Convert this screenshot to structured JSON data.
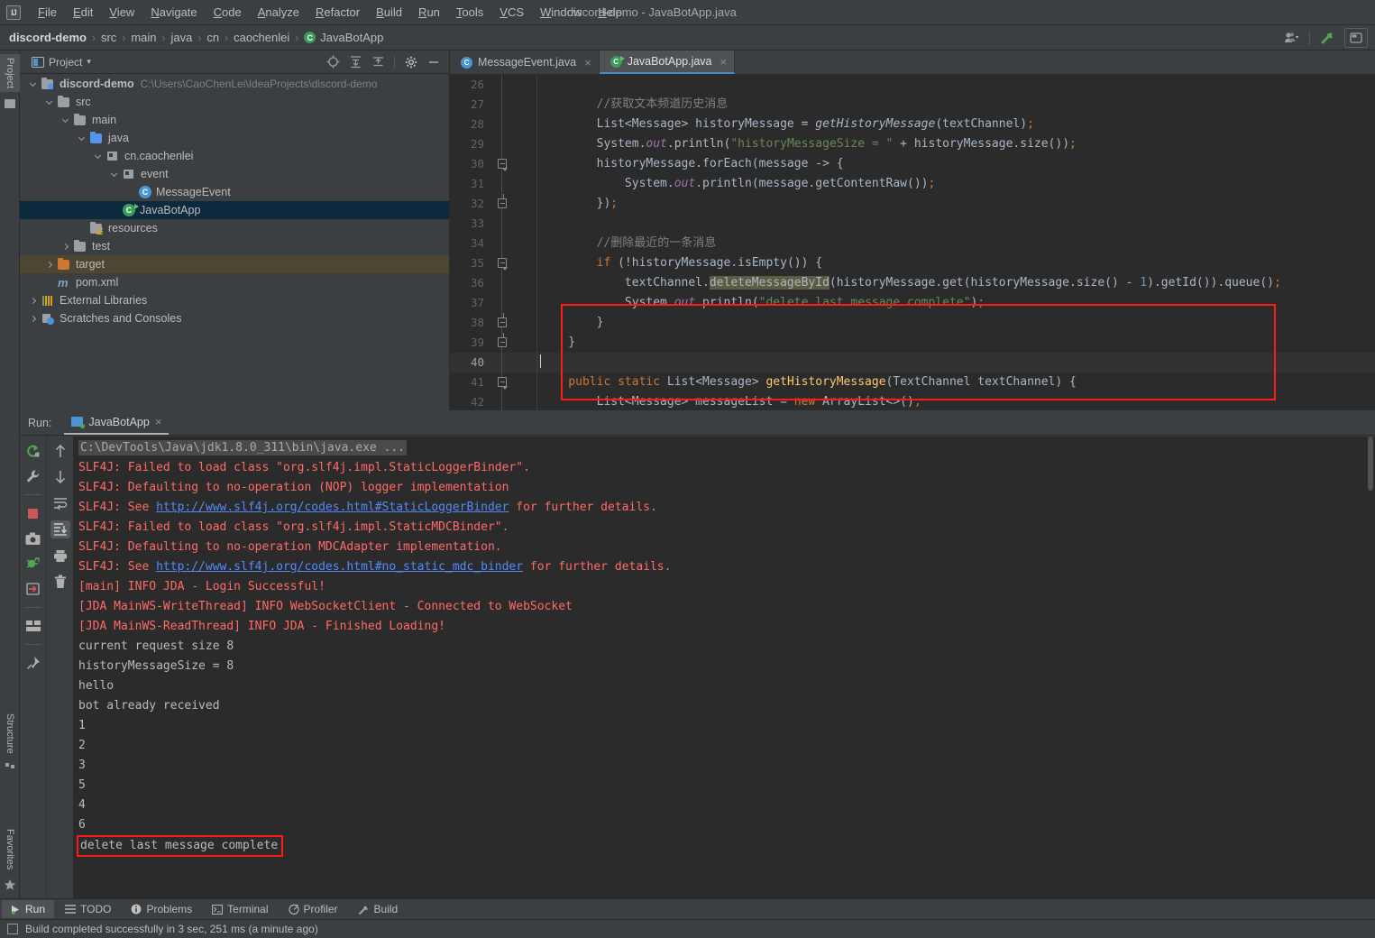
{
  "window": {
    "title": "discord-demo - JavaBotApp.java"
  },
  "menu": {
    "items": [
      "File",
      "Edit",
      "View",
      "Navigate",
      "Code",
      "Analyze",
      "Refactor",
      "Build",
      "Run",
      "Tools",
      "VCS",
      "Window",
      "Help"
    ]
  },
  "breadcrumb": {
    "items": [
      "discord-demo",
      "src",
      "main",
      "java",
      "cn",
      "caochenlei",
      "JavaBotApp"
    ],
    "separator": "›",
    "class_badge": "C"
  },
  "left_stripe": {
    "project_tab": "Project",
    "structure_tab": "Structure",
    "favorites_tab": "Favorites"
  },
  "project_panel": {
    "title": "Project",
    "chevron": "▾",
    "tree": [
      {
        "label": "discord-demo",
        "path": "C:\\Users\\CaoChenLei\\IdeaProjects\\discord-demo",
        "indent": 0,
        "arrow": "down",
        "icon": "folder-module",
        "bold": true
      },
      {
        "label": "src",
        "path": "",
        "indent": 1,
        "arrow": "down",
        "icon": "folder",
        "bold": false
      },
      {
        "label": "main",
        "path": "",
        "indent": 2,
        "arrow": "down",
        "icon": "folder",
        "bold": false
      },
      {
        "label": "java",
        "path": "",
        "indent": 3,
        "arrow": "down",
        "icon": "folder-source",
        "bold": false
      },
      {
        "label": "cn.caochenlei",
        "path": "",
        "indent": 4,
        "arrow": "down",
        "icon": "package",
        "bold": false
      },
      {
        "label": "event",
        "path": "",
        "indent": 5,
        "arrow": "down",
        "icon": "package",
        "bold": false
      },
      {
        "label": "MessageEvent",
        "path": "",
        "indent": 6,
        "arrow": "none",
        "icon": "class",
        "bold": false
      },
      {
        "label": "JavaBotApp",
        "path": "",
        "indent": 5,
        "arrow": "none",
        "icon": "class-runnable",
        "bold": false,
        "selected": true
      },
      {
        "label": "resources",
        "path": "",
        "indent": 3,
        "arrow": "none",
        "icon": "folder-resource",
        "bold": false
      },
      {
        "label": "test",
        "path": "",
        "indent": 2,
        "arrow": "right",
        "icon": "folder",
        "bold": false
      },
      {
        "label": "target",
        "path": "",
        "indent": 1,
        "arrow": "right",
        "icon": "folder-excluded",
        "bold": false,
        "highlight": true
      },
      {
        "label": "pom.xml",
        "path": "",
        "indent": 1,
        "arrow": "none",
        "icon": "maven",
        "bold": false
      },
      {
        "label": "External Libraries",
        "path": "",
        "indent": 0,
        "arrow": "right",
        "icon": "library",
        "bold": false
      },
      {
        "label": "Scratches and Consoles",
        "path": "",
        "indent": 0,
        "arrow": "right",
        "icon": "scratches",
        "bold": false
      }
    ]
  },
  "editor": {
    "tabs": [
      {
        "label": "MessageEvent.java",
        "icon": "class",
        "active": false
      },
      {
        "label": "JavaBotApp.java",
        "icon": "class-runnable",
        "active": true
      }
    ],
    "first_line_number": 26,
    "lines": [
      {
        "n": 26,
        "html": "",
        "fold": ""
      },
      {
        "n": 27,
        "html": "<span class='t-cmt'>        //获取文本频道历史消息</span>",
        "fold": ""
      },
      {
        "n": 28,
        "html": "<span class='t-id'>        List&lt;Message&gt; historyMessage = </span><span class='t-mi'>getHistoryMessage</span><span class='t-id'>(textChannel)</span><span class='t-kw'>;</span>",
        "fold": ""
      },
      {
        "n": 29,
        "html": "<span class='t-id'>        System.</span><span class='t-stat'>out</span><span class='t-id'>.println(</span><span class='t-str'>\"historyMessageSize = \"</span><span class='t-id'> + historyMessage.size())</span><span class='t-kw'>;</span>",
        "fold": ""
      },
      {
        "n": 30,
        "html": "<span class='t-id'>        historyMessage.forEach(message -&gt; {</span>",
        "fold": "start"
      },
      {
        "n": 31,
        "html": "<span class='t-id'>            System.</span><span class='t-stat'>out</span><span class='t-id'>.println(message.getContentRaw())</span><span class='t-kw'>;</span>",
        "fold": ""
      },
      {
        "n": 32,
        "html": "<span class='t-id'>        })</span><span class='t-kw'>;</span>",
        "fold": "end"
      },
      {
        "n": 33,
        "html": "",
        "fold": ""
      },
      {
        "n": 34,
        "html": "<span class='t-cmt'>        //删除最近的一条消息</span>",
        "fold": ""
      },
      {
        "n": 35,
        "html": "<span class='t-kw'>        if</span><span class='t-id'> (!historyMessage.isEmpty()) {</span>",
        "fold": "start"
      },
      {
        "n": 36,
        "html": "<span class='t-id'>            textChannel.</span><span class='t-id hl-ident'>deleteMessageById</span><span class='t-id'>(historyMessage.get(historyMessage.size() - </span><span class='t-num'>1</span><span class='t-id'>).getId()).queue()</span><span class='t-kw'>;</span>",
        "fold": ""
      },
      {
        "n": 37,
        "html": "<span class='t-id'>            System.</span><span class='t-stat'>out</span><span class='t-id'>.println(</span><span class='t-str'>\"delete last message complete\"</span><span class='t-id'>)</span><span class='t-kw'>;</span>",
        "fold": ""
      },
      {
        "n": 38,
        "html": "<span class='t-id'>        }</span>",
        "fold": "end"
      },
      {
        "n": 39,
        "html": "<span class='t-id'>    }</span>",
        "fold": "end"
      },
      {
        "n": 40,
        "html": "<span class='caret'></span>",
        "fold": "",
        "current": true
      },
      {
        "n": 41,
        "html": "<span class='t-kw'>    public static</span><span class='t-id'> List&lt;Message&gt; </span><span class='t-fn'>getHistoryMessage</span><span class='t-id'>(TextChannel textChannel) {</span>",
        "fold": "start"
      },
      {
        "n": 42,
        "html": "<span class='t-id'>        List&lt;Message&gt; messageList = </span><span class='t-kw'>new</span><span class='t-id'> ArrayList&lt;&gt;()</span><span class='t-kw'>;</span>",
        "fold": ""
      }
    ],
    "highlight_box_label": "delete-block-highlight"
  },
  "run_panel": {
    "label": "Run:",
    "tab_label": "JavaBotApp",
    "close_glyph": "×",
    "output": [
      {
        "text": "C:\\DevTools\\Java\\jdk1.8.0_311\\bin\\java.exe ...",
        "type": "cmd"
      },
      {
        "text": "SLF4J: Failed to load class \"org.slf4j.impl.StaticLoggerBinder\".",
        "type": "err"
      },
      {
        "text": "SLF4J: Defaulting to no-operation (NOP) logger implementation",
        "type": "err"
      },
      {
        "text": "SLF4J: See ",
        "type": "err",
        "link": "http://www.slf4j.org/codes.html#StaticLoggerBinder",
        "after": " for further details."
      },
      {
        "text": "SLF4J: Failed to load class \"org.slf4j.impl.StaticMDCBinder\".",
        "type": "err"
      },
      {
        "text": "SLF4J: Defaulting to no-operation MDCAdapter implementation.",
        "type": "err"
      },
      {
        "text": "SLF4J: See ",
        "type": "err",
        "link": "http://www.slf4j.org/codes.html#no_static_mdc_binder",
        "after": " for further details."
      },
      {
        "text": "[main] INFO JDA - Login Successful!",
        "type": "err"
      },
      {
        "text": "[JDA MainWS-WriteThread] INFO WebSocketClient - Connected to WebSocket",
        "type": "err"
      },
      {
        "text": "[JDA MainWS-ReadThread] INFO JDA - Finished Loading!",
        "type": "err"
      },
      {
        "text": "current request size 8",
        "type": "out"
      },
      {
        "text": "historyMessageSize = 8",
        "type": "out"
      },
      {
        "text": "hello",
        "type": "out"
      },
      {
        "text": "bot already received",
        "type": "out"
      },
      {
        "text": "1",
        "type": "out"
      },
      {
        "text": "2",
        "type": "out"
      },
      {
        "text": "3",
        "type": "out"
      },
      {
        "text": "5",
        "type": "out"
      },
      {
        "text": "4",
        "type": "out"
      },
      {
        "text": "6",
        "type": "out"
      },
      {
        "text": "delete last message complete",
        "type": "out",
        "boxed": true
      }
    ]
  },
  "bottom_tabs": [
    {
      "label": "Run",
      "icon": "run-icon",
      "selected": true
    },
    {
      "label": "TODO",
      "icon": "todo-icon",
      "selected": false
    },
    {
      "label": "Problems",
      "icon": "problems-icon",
      "selected": false
    },
    {
      "label": "Terminal",
      "icon": "terminal-icon",
      "selected": false
    },
    {
      "label": "Profiler",
      "icon": "profiler-icon",
      "selected": false
    },
    {
      "label": "Build",
      "icon": "build-icon",
      "selected": false
    }
  ],
  "status": {
    "message": "Build completed successfully in 3 sec, 251 ms (a minute ago)"
  },
  "colors": {
    "accent_red": "#ff1a1a",
    "editor_bg": "#2b2b2b",
    "panel_bg": "#3c3f41",
    "selection_blue": "#0d293e",
    "link_blue": "#548af7",
    "error_red": "#ff6b68",
    "string_green": "#6a8759",
    "keyword_orange": "#cc7832"
  }
}
